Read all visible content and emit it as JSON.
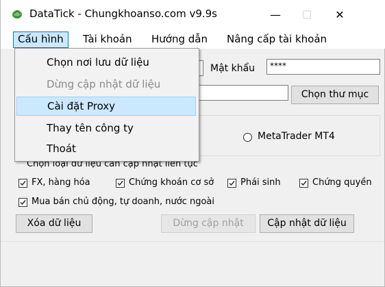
{
  "window": {
    "title": "DataTick - Chungkhoanso.com v9.9s",
    "minimize": "—",
    "maximize": "☐",
    "close": "✕"
  },
  "menubar": {
    "items": [
      "Cấu hình",
      "Tài khoản",
      "Hướng dẫn",
      "Nâng cấp tài khoản"
    ]
  },
  "dropdown": {
    "items": [
      {
        "label": "Chọn nơi lưu dữ liệu",
        "enabled": true
      },
      {
        "label": "Dừng cập nhật dữ liệu",
        "enabled": false
      },
      {
        "label": "Cài đặt Proxy",
        "enabled": true,
        "highlighted": true
      },
      {
        "label": "Thay tên công ty",
        "enabled": true
      },
      {
        "label": "Thoát",
        "enabled": true
      }
    ]
  },
  "form": {
    "password_label": "Mật khẩu",
    "password_value": "****",
    "choose_folder_button": "Chọn thư mục",
    "radio_mt4": "MetaTrader MT4",
    "continuous_label": "Chọn loại dữ liệu cần cập nhật liên tục",
    "checkboxes": [
      {
        "label": "FX, hàng hóa",
        "checked": true
      },
      {
        "label": "Chứng khoán cơ sở",
        "checked": true
      },
      {
        "label": "Phái sinh",
        "checked": true
      },
      {
        "label": "Chứng quyền",
        "checked": true
      },
      {
        "label": "Mua bán chủ động, tự doanh, nước ngoài",
        "checked": true
      }
    ],
    "delete_button": "Xóa dữ liệu",
    "stop_button": "Dừng cập nhật",
    "update_button": "Cập nhật dữ liệu"
  },
  "colors": {
    "menu_highlight": "#cce8ff",
    "menu_highlight_border": "#99d1ff",
    "active_menu_border": "#0078d7"
  }
}
